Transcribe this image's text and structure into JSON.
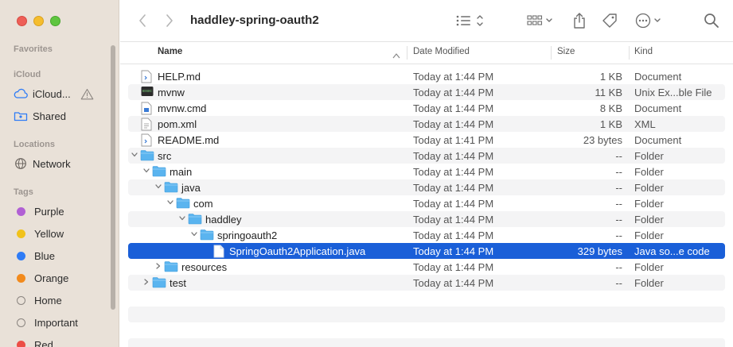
{
  "window": {
    "title": "haddley-spring-oauth2"
  },
  "sidebar": {
    "favorites_header": "Favorites",
    "icloud_header": "iCloud",
    "icloud_drive_label": "iCloud...",
    "shared_label": "Shared",
    "locations_header": "Locations",
    "network_label": "Network",
    "tags_header": "Tags",
    "tags": [
      {
        "label": "Purple",
        "color": "#b160d4"
      },
      {
        "label": "Yellow",
        "color": "#f1c21b"
      },
      {
        "label": "Blue",
        "color": "#2f7cf6"
      },
      {
        "label": "Orange",
        "color": "#f28a1c"
      },
      {
        "label": "Home",
        "color": ""
      },
      {
        "label": "Important",
        "color": ""
      },
      {
        "label": "Red",
        "color": "#ec4e46"
      }
    ]
  },
  "columns": {
    "name": "Name",
    "date": "Date Modified",
    "size": "Size",
    "kind": "Kind"
  },
  "rows": [
    {
      "name": "HELP.md",
      "date": "Today at 1:44 PM",
      "size": "1 KB",
      "kind": "Document"
    },
    {
      "name": "mvnw",
      "date": "Today at 1:44 PM",
      "size": "11 KB",
      "kind": "Unix Ex...ble File"
    },
    {
      "name": "mvnw.cmd",
      "date": "Today at 1:44 PM",
      "size": "8 KB",
      "kind": "Document"
    },
    {
      "name": "pom.xml",
      "date": "Today at 1:44 PM",
      "size": "1 KB",
      "kind": "XML"
    },
    {
      "name": "README.md",
      "date": "Today at 1:41 PM",
      "size": "23 bytes",
      "kind": "Document"
    },
    {
      "name": "src",
      "date": "Today at 1:44 PM",
      "size": "--",
      "kind": "Folder"
    },
    {
      "name": "main",
      "date": "Today at 1:44 PM",
      "size": "--",
      "kind": "Folder"
    },
    {
      "name": "java",
      "date": "Today at 1:44 PM",
      "size": "--",
      "kind": "Folder"
    },
    {
      "name": "com",
      "date": "Today at 1:44 PM",
      "size": "--",
      "kind": "Folder"
    },
    {
      "name": "haddley",
      "date": "Today at 1:44 PM",
      "size": "--",
      "kind": "Folder"
    },
    {
      "name": "springoauth2",
      "date": "Today at 1:44 PM",
      "size": "--",
      "kind": "Folder"
    },
    {
      "name": "SpringOauth2Application.java",
      "date": "Today at 1:44 PM",
      "size": "329 bytes",
      "kind": "Java so...e code"
    },
    {
      "name": "resources",
      "date": "Today at 1:44 PM",
      "size": "--",
      "kind": "Folder"
    },
    {
      "name": "test",
      "date": "Today at 1:44 PM",
      "size": "--",
      "kind": "Folder"
    }
  ],
  "colors": {
    "selection": "#1a5fd8",
    "folder": "#5ab4ef",
    "sidebar_bg": "#e9e1d8"
  }
}
